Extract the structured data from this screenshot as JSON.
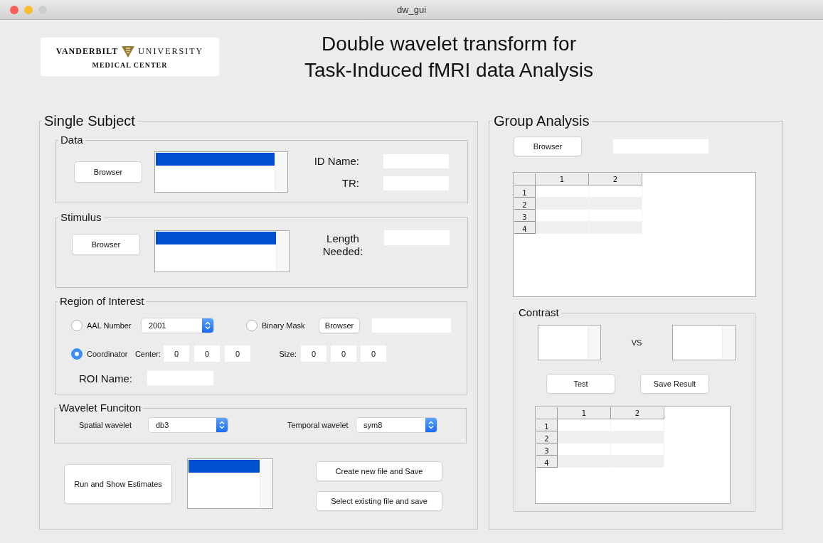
{
  "window": {
    "title": "dw_gui"
  },
  "logo": {
    "left_word": "VANDERBILT",
    "right_word": "UNIVERSITY",
    "subtitle": "MEDICAL CENTER"
  },
  "heading_lines": [
    "Double wavelet transform for",
    "Task-Induced fMRI data Analysis"
  ],
  "single_subject": {
    "title": "Single Subject",
    "data": {
      "title": "Data",
      "browse_button": "Browser",
      "file_list": {
        "items": [
          {
            "selected": true
          }
        ]
      },
      "id_label": "ID Name:",
      "tr_label": "TR:"
    },
    "stimulus": {
      "title": "Stimulus",
      "browse_button": "Browser",
      "file_list": {
        "items": [
          {
            "selected": true
          }
        ]
      },
      "length_label": "Length Needed:"
    },
    "roi": {
      "title": "Region of Interest",
      "options": [
        {
          "label": "AAL Number",
          "selected": false
        },
        {
          "label": "Binary Mask",
          "selected": false
        },
        {
          "label": "Coordinator",
          "selected": true
        }
      ],
      "aal_value": "2001",
      "mask_button": "Browser",
      "center": {
        "label": "Center:",
        "values": [
          "0",
          "0",
          "0"
        ]
      },
      "size": {
        "label": "Size:",
        "values": [
          "0",
          "0",
          "0"
        ]
      },
      "name_label": "ROI Name:"
    },
    "wavelet": {
      "title": "Wavelet Funciton",
      "spatial_label": "Spatial wavelet",
      "spatial_value": "db3",
      "temporal_label": "Temporal wavelet",
      "temporal_value": "sym8"
    },
    "run_button": "Run and Show Estimates",
    "result_list": {
      "items": [
        {
          "selected": true
        }
      ]
    },
    "save_buttons": [
      "Create new file and Save",
      "Select existing file and save"
    ]
  },
  "group_analysis": {
    "title": "Group Analysis",
    "browse_button": "Browser",
    "table": {
      "columns": [
        "1",
        "2"
      ],
      "rows": [
        "1",
        "2",
        "3",
        "4"
      ]
    },
    "contrast": {
      "title": "Contrast",
      "vs_label": "VS",
      "buttons": [
        "Test",
        "Save Result"
      ],
      "table": {
        "columns": [
          "1",
          "2"
        ],
        "rows": [
          "1",
          "2",
          "3",
          "4"
        ]
      }
    }
  }
}
